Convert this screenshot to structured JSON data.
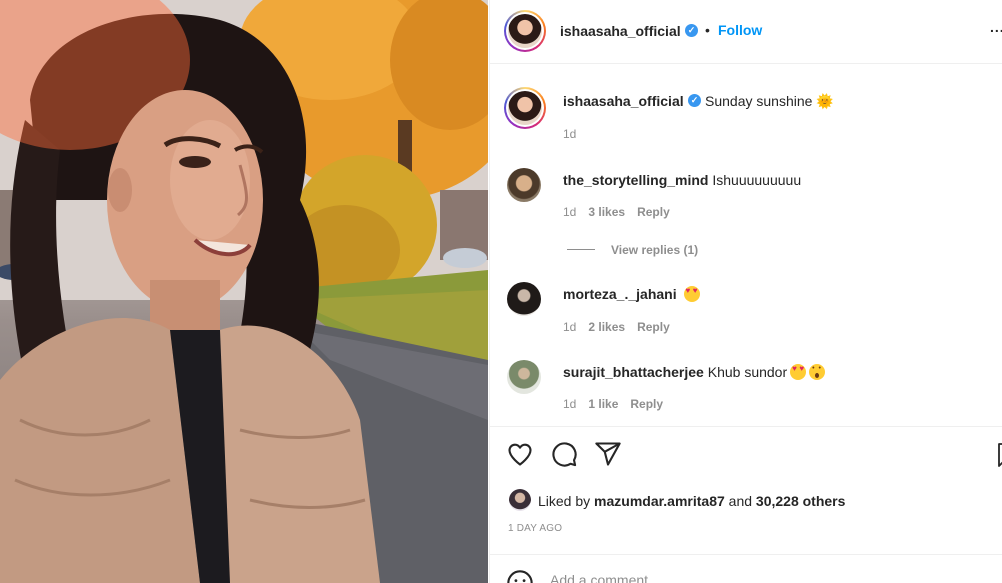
{
  "header": {
    "username": "ishaasaha_official",
    "separator": "•",
    "follow_label": "Follow",
    "more_label": "..."
  },
  "caption": {
    "username": "ishaasaha_official",
    "text": "Sunday sunshine",
    "emoji": "🌞",
    "time": "1d"
  },
  "comments": [
    {
      "username": "the_storytelling_mind",
      "text": "Ishuuuuuuuuu",
      "time": "1d",
      "likes": "3 likes",
      "reply": "Reply",
      "view_replies": "View replies (1)"
    },
    {
      "username": "morteza_._jahani",
      "text": "",
      "time": "1d",
      "likes": "2 likes",
      "reply": "Reply"
    },
    {
      "username": "surajit_bhattacherjee",
      "text": "Khub sundor",
      "time": "1d",
      "likes": "1 like",
      "reply": "Reply"
    }
  ],
  "likes": {
    "prefix": "Liked by",
    "user": "mazumdar.amrita87",
    "conj": "and",
    "others": "30,228 others"
  },
  "time_ago": "1 DAY AGO",
  "comment_box": {
    "placeholder": "Add a comment..."
  },
  "colors": {
    "accent": "#0095f6",
    "muted": "#8e8e8e",
    "verified": "#3897f0"
  }
}
